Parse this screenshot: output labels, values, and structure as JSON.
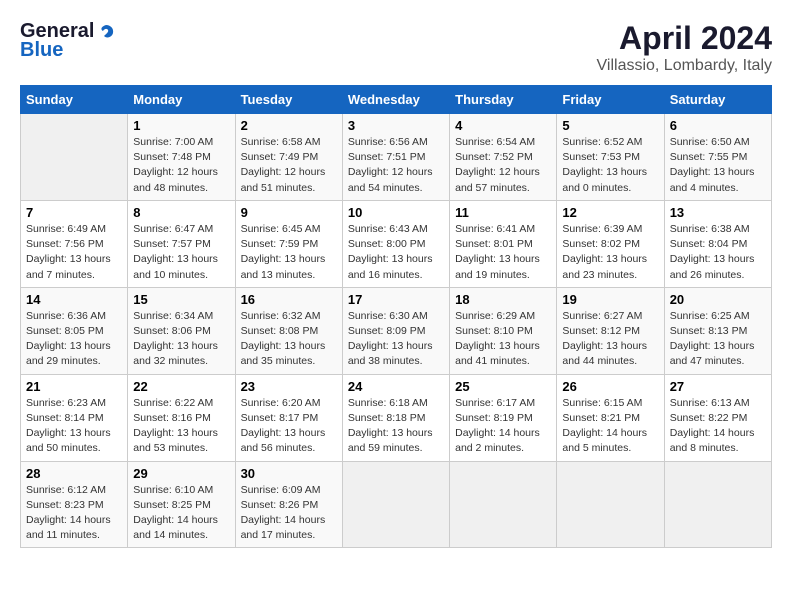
{
  "header": {
    "logo_general": "General",
    "logo_blue": "Blue",
    "month_title": "April 2024",
    "subtitle": "Villassio, Lombardy, Italy"
  },
  "calendar": {
    "days_of_week": [
      "Sunday",
      "Monday",
      "Tuesday",
      "Wednesday",
      "Thursday",
      "Friday",
      "Saturday"
    ],
    "weeks": [
      [
        {
          "day": "",
          "info": ""
        },
        {
          "day": "1",
          "info": "Sunrise: 7:00 AM\nSunset: 7:48 PM\nDaylight: 12 hours\nand 48 minutes."
        },
        {
          "day": "2",
          "info": "Sunrise: 6:58 AM\nSunset: 7:49 PM\nDaylight: 12 hours\nand 51 minutes."
        },
        {
          "day": "3",
          "info": "Sunrise: 6:56 AM\nSunset: 7:51 PM\nDaylight: 12 hours\nand 54 minutes."
        },
        {
          "day": "4",
          "info": "Sunrise: 6:54 AM\nSunset: 7:52 PM\nDaylight: 12 hours\nand 57 minutes."
        },
        {
          "day": "5",
          "info": "Sunrise: 6:52 AM\nSunset: 7:53 PM\nDaylight: 13 hours\nand 0 minutes."
        },
        {
          "day": "6",
          "info": "Sunrise: 6:50 AM\nSunset: 7:55 PM\nDaylight: 13 hours\nand 4 minutes."
        }
      ],
      [
        {
          "day": "7",
          "info": "Sunrise: 6:49 AM\nSunset: 7:56 PM\nDaylight: 13 hours\nand 7 minutes."
        },
        {
          "day": "8",
          "info": "Sunrise: 6:47 AM\nSunset: 7:57 PM\nDaylight: 13 hours\nand 10 minutes."
        },
        {
          "day": "9",
          "info": "Sunrise: 6:45 AM\nSunset: 7:59 PM\nDaylight: 13 hours\nand 13 minutes."
        },
        {
          "day": "10",
          "info": "Sunrise: 6:43 AM\nSunset: 8:00 PM\nDaylight: 13 hours\nand 16 minutes."
        },
        {
          "day": "11",
          "info": "Sunrise: 6:41 AM\nSunset: 8:01 PM\nDaylight: 13 hours\nand 19 minutes."
        },
        {
          "day": "12",
          "info": "Sunrise: 6:39 AM\nSunset: 8:02 PM\nDaylight: 13 hours\nand 23 minutes."
        },
        {
          "day": "13",
          "info": "Sunrise: 6:38 AM\nSunset: 8:04 PM\nDaylight: 13 hours\nand 26 minutes."
        }
      ],
      [
        {
          "day": "14",
          "info": "Sunrise: 6:36 AM\nSunset: 8:05 PM\nDaylight: 13 hours\nand 29 minutes."
        },
        {
          "day": "15",
          "info": "Sunrise: 6:34 AM\nSunset: 8:06 PM\nDaylight: 13 hours\nand 32 minutes."
        },
        {
          "day": "16",
          "info": "Sunrise: 6:32 AM\nSunset: 8:08 PM\nDaylight: 13 hours\nand 35 minutes."
        },
        {
          "day": "17",
          "info": "Sunrise: 6:30 AM\nSunset: 8:09 PM\nDaylight: 13 hours\nand 38 minutes."
        },
        {
          "day": "18",
          "info": "Sunrise: 6:29 AM\nSunset: 8:10 PM\nDaylight: 13 hours\nand 41 minutes."
        },
        {
          "day": "19",
          "info": "Sunrise: 6:27 AM\nSunset: 8:12 PM\nDaylight: 13 hours\nand 44 minutes."
        },
        {
          "day": "20",
          "info": "Sunrise: 6:25 AM\nSunset: 8:13 PM\nDaylight: 13 hours\nand 47 minutes."
        }
      ],
      [
        {
          "day": "21",
          "info": "Sunrise: 6:23 AM\nSunset: 8:14 PM\nDaylight: 13 hours\nand 50 minutes."
        },
        {
          "day": "22",
          "info": "Sunrise: 6:22 AM\nSunset: 8:16 PM\nDaylight: 13 hours\nand 53 minutes."
        },
        {
          "day": "23",
          "info": "Sunrise: 6:20 AM\nSunset: 8:17 PM\nDaylight: 13 hours\nand 56 minutes."
        },
        {
          "day": "24",
          "info": "Sunrise: 6:18 AM\nSunset: 8:18 PM\nDaylight: 13 hours\nand 59 minutes."
        },
        {
          "day": "25",
          "info": "Sunrise: 6:17 AM\nSunset: 8:19 PM\nDaylight: 14 hours\nand 2 minutes."
        },
        {
          "day": "26",
          "info": "Sunrise: 6:15 AM\nSunset: 8:21 PM\nDaylight: 14 hours\nand 5 minutes."
        },
        {
          "day": "27",
          "info": "Sunrise: 6:13 AM\nSunset: 8:22 PM\nDaylight: 14 hours\nand 8 minutes."
        }
      ],
      [
        {
          "day": "28",
          "info": "Sunrise: 6:12 AM\nSunset: 8:23 PM\nDaylight: 14 hours\nand 11 minutes."
        },
        {
          "day": "29",
          "info": "Sunrise: 6:10 AM\nSunset: 8:25 PM\nDaylight: 14 hours\nand 14 minutes."
        },
        {
          "day": "30",
          "info": "Sunrise: 6:09 AM\nSunset: 8:26 PM\nDaylight: 14 hours\nand 17 minutes."
        },
        {
          "day": "",
          "info": ""
        },
        {
          "day": "",
          "info": ""
        },
        {
          "day": "",
          "info": ""
        },
        {
          "day": "",
          "info": ""
        }
      ]
    ]
  }
}
